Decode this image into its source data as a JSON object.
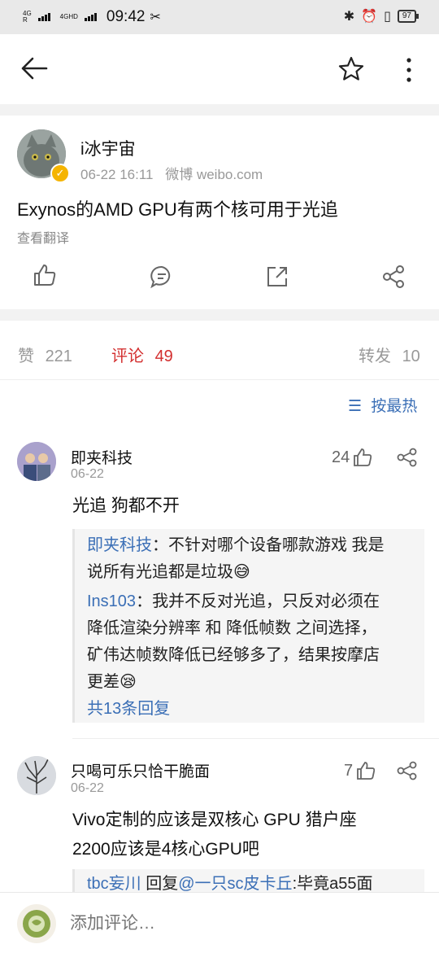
{
  "status": {
    "signal1": "4G",
    "signal1_sub": "R",
    "signal2": "4GHD",
    "time": "09:42",
    "battery": "97"
  },
  "post": {
    "author": "i冰宇宙",
    "datetime": "06-22 16:11",
    "source": "微博 weibo.com",
    "text": "Exynos的AMD GPU有两个核可用于光追",
    "translate": "查看翻译"
  },
  "stats": {
    "likes_label": "赞",
    "likes": "221",
    "comments_label": "评论",
    "comments": "49",
    "reposts_label": "转发",
    "reposts": "10"
  },
  "sort": {
    "label": "按最热"
  },
  "comments": [
    {
      "name": "即夹科技",
      "date": "06-22",
      "likes": "24",
      "text": "光追 狗都不开",
      "replies": [
        {
          "user": "即夹科技",
          "sep": "：",
          "text_1": "不针对哪个设备哪款游戏 我是",
          "text_2": "说所有光追都是垃圾",
          "emoji": "😅"
        },
        {
          "user": "Ins103",
          "sep": "：",
          "text_1": "我并不反对光追，只反对必须在",
          "text_2": "降低渲染分辨率 和 降低帧数 之间选择，",
          "text_3": "矿伟达帧数降低已经够多了，结果按摩店",
          "text_4": "更差",
          "emoji": "😪"
        }
      ],
      "more": "共13条回复"
    },
    {
      "name": "只喝可乐只恰干脆面",
      "date": "06-22",
      "likes": "7",
      "text_1": "Vivo定制的应该是双核心 GPU 猎户座",
      "text_2": "2200应该是4核心GPU吧",
      "reply_user": "tbc妄川",
      "reply_mid": " 回复",
      "reply_target": "@一只sc皮卡丘",
      "reply_text": ":毕竟a55面"
    }
  ],
  "composer": {
    "placeholder": "添加评论…"
  }
}
